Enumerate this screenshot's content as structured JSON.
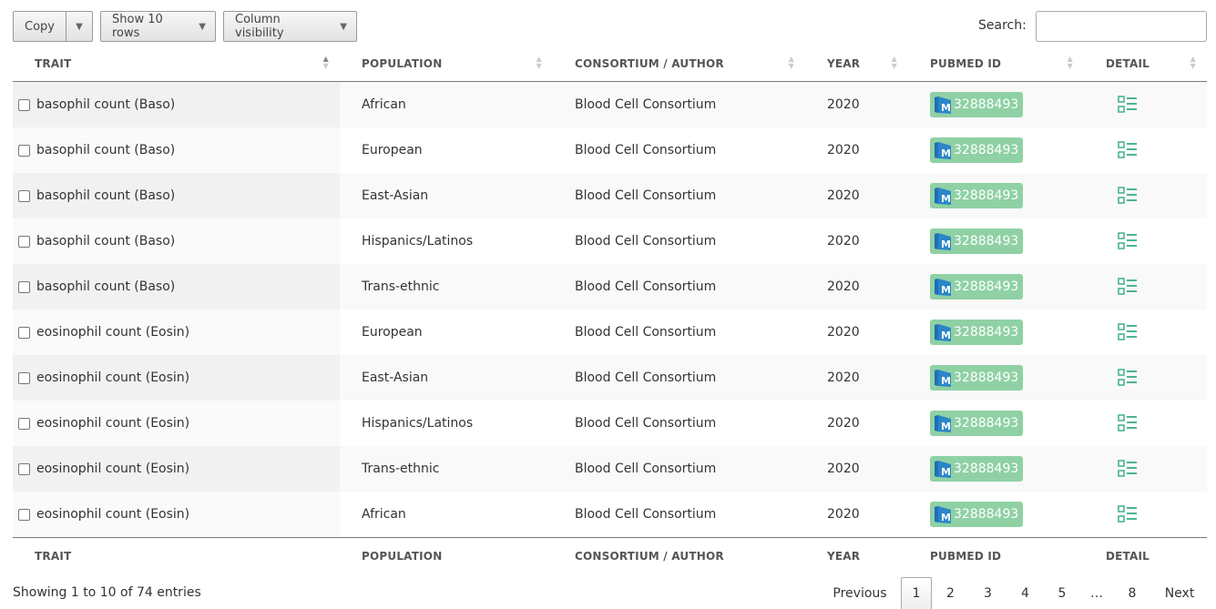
{
  "toolbar": {
    "copy_label": "Copy",
    "show_rows_label": "Show 10 rows",
    "column_visibility_label": "Column visibility",
    "search_label": "Search:",
    "search_value": ""
  },
  "table": {
    "headers": [
      "TRAIT",
      "POPULATION",
      "CONSORTIUM / AUTHOR",
      "YEAR",
      "PUBMED ID",
      "DETAIL"
    ],
    "rows": [
      {
        "trait": "basophil count (Baso)",
        "population": "African",
        "consortium": "Blood Cell Consortium",
        "year": "2020",
        "pubmed": "32888493"
      },
      {
        "trait": "basophil count (Baso)",
        "population": "European",
        "consortium": "Blood Cell Consortium",
        "year": "2020",
        "pubmed": "32888493"
      },
      {
        "trait": "basophil count (Baso)",
        "population": "East-Asian",
        "consortium": "Blood Cell Consortium",
        "year": "2020",
        "pubmed": "32888493"
      },
      {
        "trait": "basophil count (Baso)",
        "population": "Hispanics/Latinos",
        "consortium": "Blood Cell Consortium",
        "year": "2020",
        "pubmed": "32888493"
      },
      {
        "trait": "basophil count (Baso)",
        "population": "Trans-ethnic",
        "consortium": "Blood Cell Consortium",
        "year": "2020",
        "pubmed": "32888493"
      },
      {
        "trait": "eosinophil count (Eosin)",
        "population": "European",
        "consortium": "Blood Cell Consortium",
        "year": "2020",
        "pubmed": "32888493"
      },
      {
        "trait": "eosinophil count (Eosin)",
        "population": "East-Asian",
        "consortium": "Blood Cell Consortium",
        "year": "2020",
        "pubmed": "32888493"
      },
      {
        "trait": "eosinophil count (Eosin)",
        "population": "Hispanics/Latinos",
        "consortium": "Blood Cell Consortium",
        "year": "2020",
        "pubmed": "32888493"
      },
      {
        "trait": "eosinophil count (Eosin)",
        "population": "Trans-ethnic",
        "consortium": "Blood Cell Consortium",
        "year": "2020",
        "pubmed": "32888493"
      },
      {
        "trait": "eosinophil count (Eosin)",
        "population": "African",
        "consortium": "Blood Cell Consortium",
        "year": "2020",
        "pubmed": "32888493"
      }
    ]
  },
  "footer": {
    "info": "Showing 1 to 10 of 74 entries",
    "previous": "Previous",
    "pages": [
      "1",
      "2",
      "3",
      "4",
      "5"
    ],
    "ellipsis": "…",
    "last_page": "8",
    "next": "Next",
    "current_page": "1"
  },
  "colors": {
    "pubmed_badge": "#8fd1a4",
    "detail_icon": "#4cb48f",
    "accent_blue": "#1f6fb5"
  },
  "icons": {
    "pubmed": "pubmed-logo-icon",
    "detail": "detail-list-icon",
    "caret": "caret-down-icon",
    "sort": "sort-arrows-icon"
  }
}
